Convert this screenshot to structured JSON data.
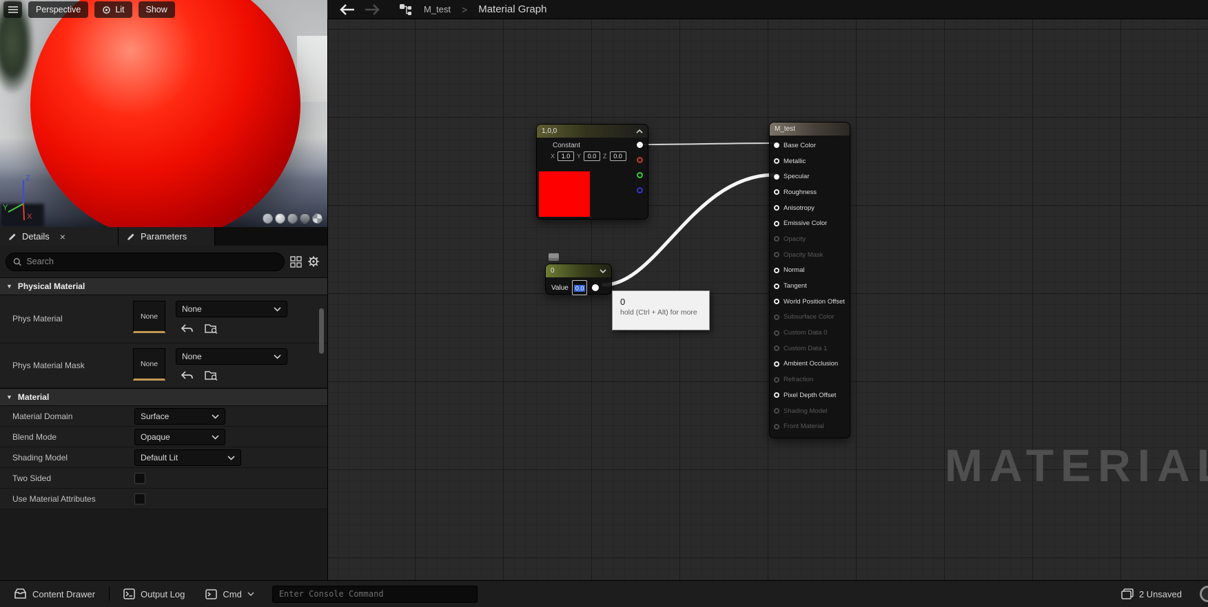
{
  "colors": {
    "selection_blue": "#3566d6",
    "asset_underline": "#c49a54"
  },
  "viewport": {
    "buttons": [
      {
        "label": "Perspective"
      },
      {
        "label": "Lit"
      },
      {
        "label": "Show"
      }
    ],
    "axis": {
      "x": "X",
      "y": "Y",
      "z": "Z"
    }
  },
  "details_panel": {
    "tabs": [
      {
        "label": "Details"
      },
      {
        "label": "Parameters"
      }
    ],
    "search": {
      "placeholder": "Search"
    },
    "physical_material_section": {
      "title": "Physical Material",
      "rows": [
        {
          "label": "Phys Material",
          "thumbnail": "None",
          "dropdown": "None"
        },
        {
          "label": "Phys Material Mask",
          "thumbnail": "None",
          "dropdown": "None"
        }
      ]
    },
    "material_section": {
      "title": "Material",
      "rows": [
        {
          "label": "Material Domain",
          "type": "dropdown",
          "value": "Surface"
        },
        {
          "label": "Blend Mode",
          "type": "dropdown",
          "value": "Opaque"
        },
        {
          "label": "Shading Model",
          "type": "dropdown",
          "value": "Default Lit"
        },
        {
          "label": "Two Sided",
          "type": "checkbox",
          "checked": false
        },
        {
          "label": "Use Material Attributes",
          "type": "checkbox",
          "checked": false
        }
      ]
    }
  },
  "graph": {
    "breadcrumb": {
      "root": "M_test",
      "separator": ">",
      "current": "Material Graph"
    },
    "watermark": "MATERIAL",
    "constant_node": {
      "title": "1,0,0",
      "type_label": "Constant",
      "fields": [
        {
          "label": "X",
          "value": "1.0"
        },
        {
          "label": "Y",
          "value": "0.0"
        },
        {
          "label": "Z",
          "value": "0.0"
        }
      ],
      "preview_color": "#ff0000",
      "pin_colors": [
        "#ffffff",
        "#cd3732",
        "#33cd32",
        "#3435cd"
      ]
    },
    "scalar_node": {
      "title": "0",
      "value_label": "Value",
      "value": "0.0"
    },
    "tooltip": {
      "title": "0",
      "hint": "hold (Ctrl + Alt) for more"
    },
    "result_node": {
      "title": "M_test",
      "pins": [
        {
          "label": "Base Color",
          "connected": true,
          "enabled": true
        },
        {
          "label": "Metallic",
          "connected": false,
          "enabled": true
        },
        {
          "label": "Specular",
          "connected": true,
          "enabled": true
        },
        {
          "label": "Roughness",
          "connected": false,
          "enabled": true
        },
        {
          "label": "Anisotropy",
          "connected": false,
          "enabled": true
        },
        {
          "label": "Emissive Color",
          "connected": false,
          "enabled": true
        },
        {
          "label": "Opacity",
          "connected": false,
          "enabled": false
        },
        {
          "label": "Opacity Mask",
          "connected": false,
          "enabled": false
        },
        {
          "label": "Normal",
          "connected": false,
          "enabled": true
        },
        {
          "label": "Tangent",
          "connected": false,
          "enabled": true
        },
        {
          "label": "World Position Offset",
          "connected": false,
          "enabled": true
        },
        {
          "label": "Subsurface Color",
          "connected": false,
          "enabled": false
        },
        {
          "label": "Custom Data 0",
          "connected": false,
          "enabled": false
        },
        {
          "label": "Custom Data 1",
          "connected": false,
          "enabled": false
        },
        {
          "label": "Ambient Occlusion",
          "connected": false,
          "enabled": true
        },
        {
          "label": "Refraction",
          "connected": false,
          "enabled": false
        },
        {
          "label": "Pixel Depth Offset",
          "connected": false,
          "enabled": true
        },
        {
          "label": "Shading Model",
          "connected": false,
          "enabled": false
        },
        {
          "label": "Front Material",
          "connected": false,
          "enabled": false
        }
      ]
    }
  },
  "status_bar": {
    "content_drawer": "Content Drawer",
    "output_log": "Output Log",
    "cmd": "Cmd",
    "console_placeholder": "Enter Console Command",
    "unsaved": "2 Unsaved"
  }
}
